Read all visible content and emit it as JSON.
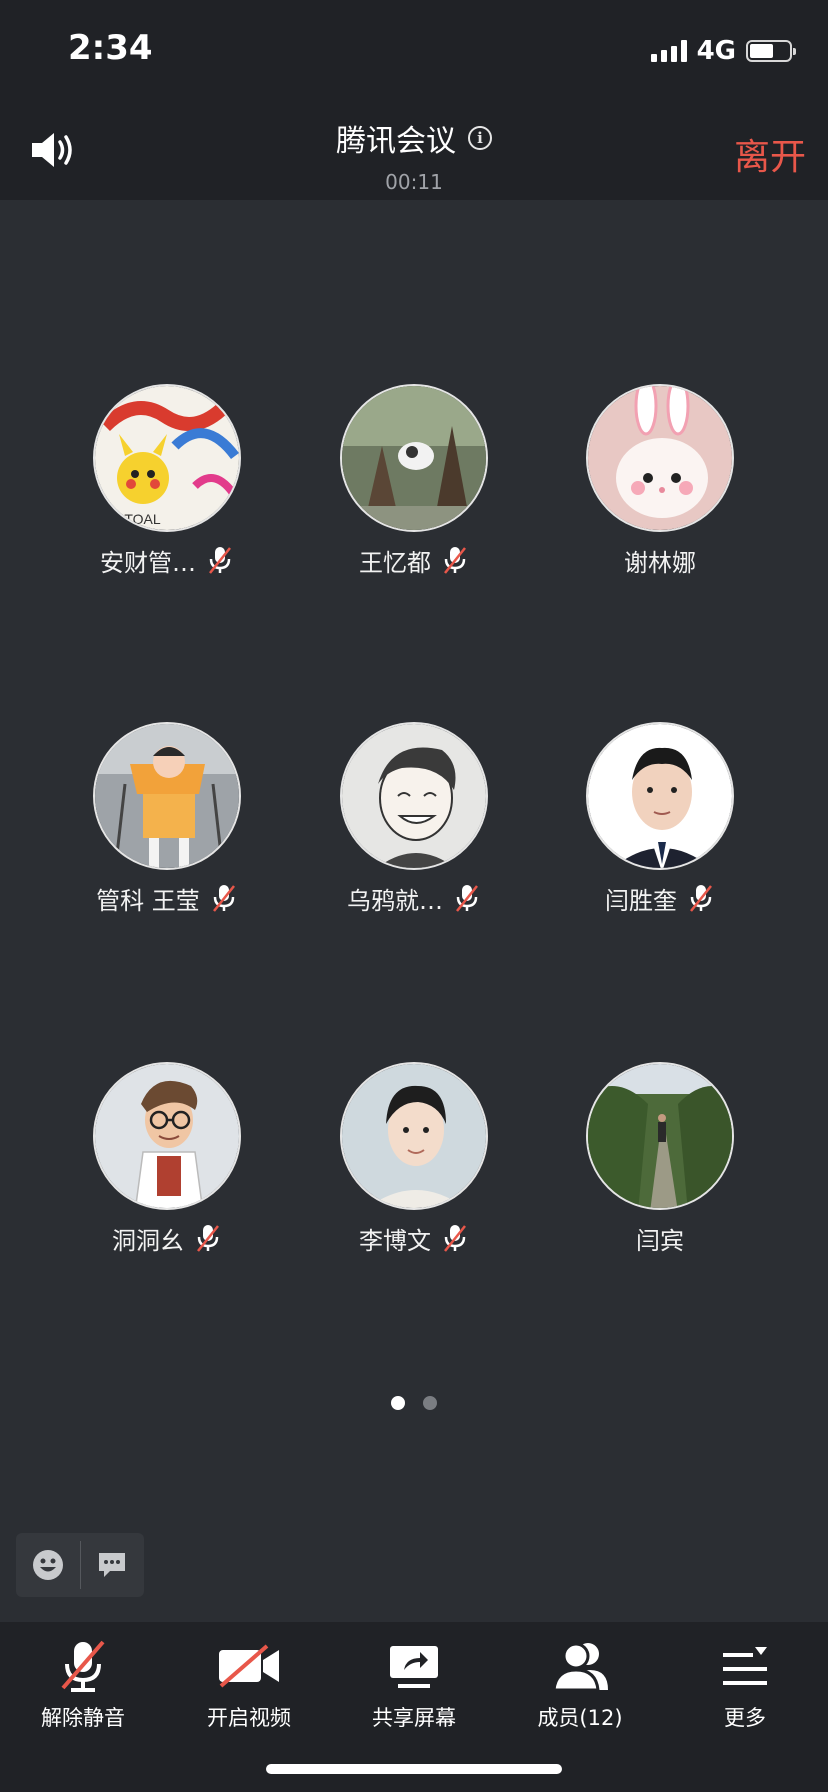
{
  "status_bar": {
    "time": "2:34",
    "network": "4G",
    "battery_level": 0.6
  },
  "header": {
    "title": "腾讯会议",
    "timer": "00:11",
    "leave_label": "离开"
  },
  "participants": [
    {
      "name": "安财管…",
      "muted": true,
      "avatar": "pikachu-drawing"
    },
    {
      "name": "王忆都",
      "muted": true,
      "avatar": "cat-in-tree"
    },
    {
      "name": "谢林娜",
      "muted": false,
      "avatar": "white-kitten-bunny-ears"
    },
    {
      "name": "管科 王莹",
      "muted": true,
      "avatar": "baby-in-stroller"
    },
    {
      "name": "乌鸦就…",
      "muted": true,
      "avatar": "anime-boy"
    },
    {
      "name": "闫胜奎",
      "muted": true,
      "avatar": "man-in-suit"
    },
    {
      "name": "洞洞幺",
      "muted": true,
      "avatar": "cartoon-scientist"
    },
    {
      "name": "李博文",
      "muted": true,
      "avatar": "young-man-sweater"
    },
    {
      "name": "闫宾",
      "muted": false,
      "avatar": "forest-path"
    }
  ],
  "pagination": {
    "current": 1,
    "total": 2
  },
  "toolbar": {
    "unmute_label": "解除静音",
    "video_label": "开启视频",
    "share_label": "共享屏幕",
    "members_label": "成员(12)",
    "more_label": "更多"
  },
  "colors": {
    "accent_leave": "#e8574a",
    "background": "#2b2e33",
    "bar": "#202226"
  }
}
